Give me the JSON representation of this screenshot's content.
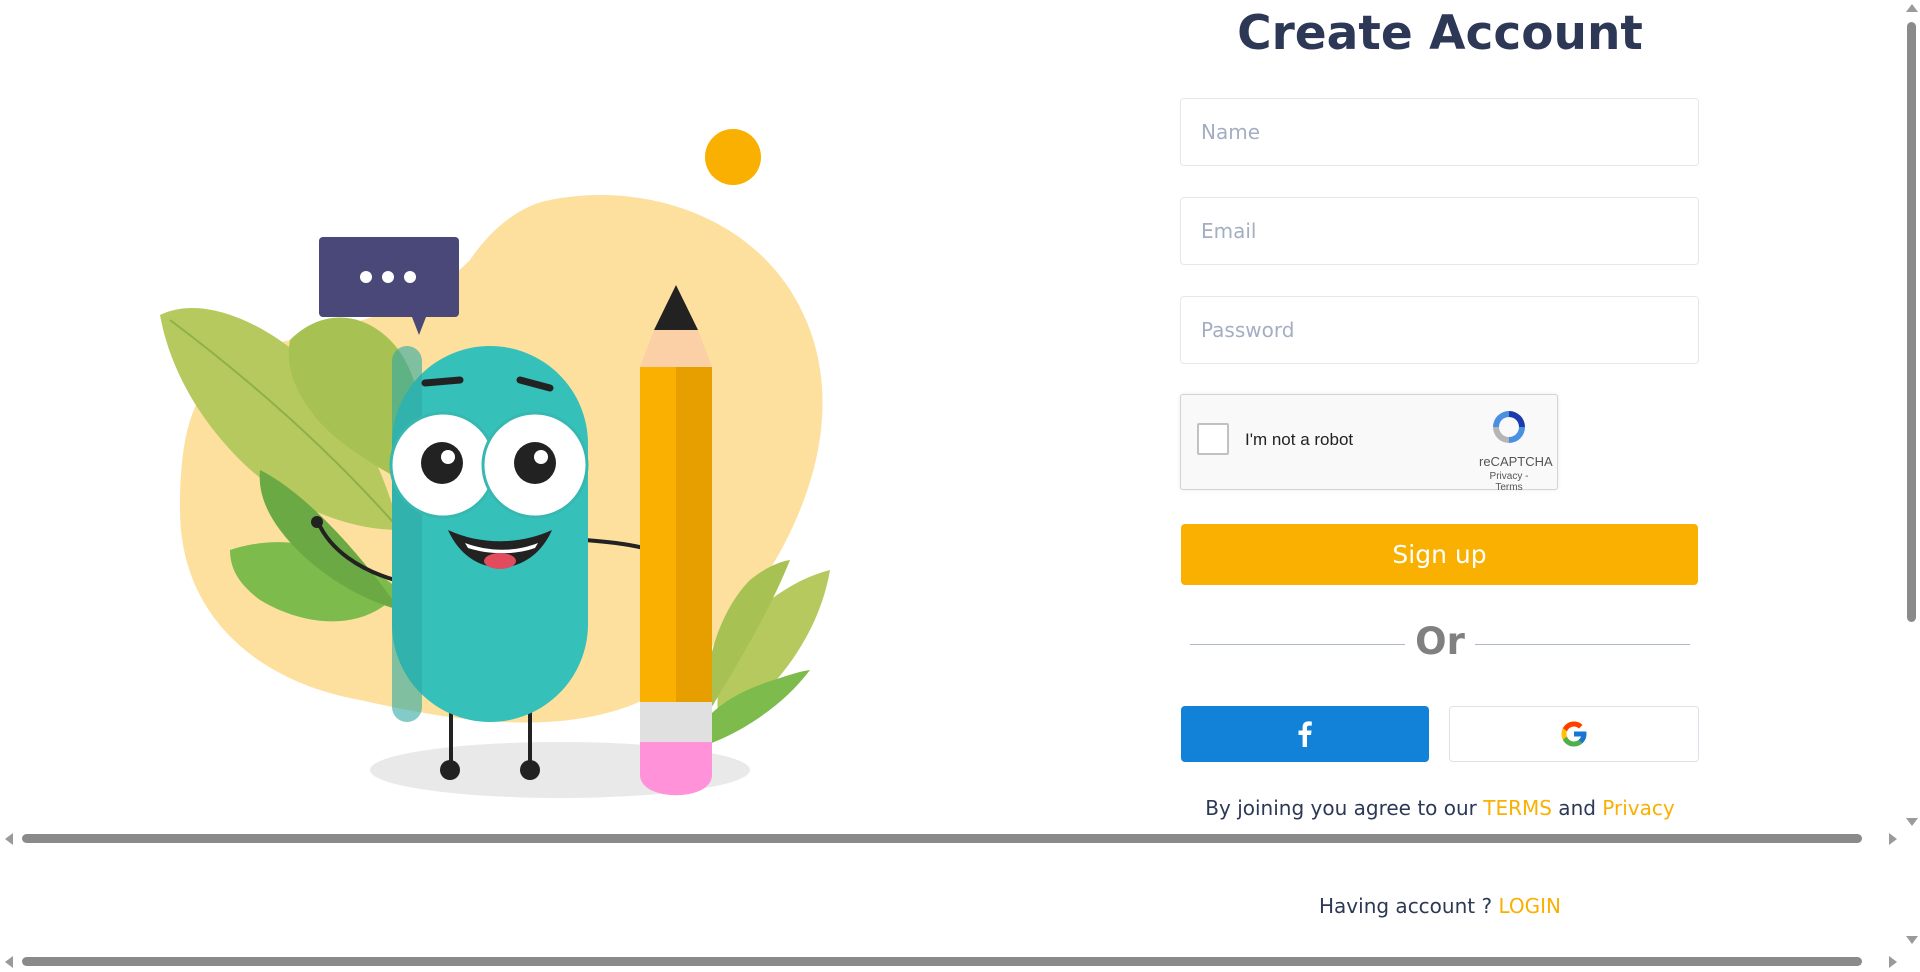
{
  "page": {
    "title": "Create Account"
  },
  "form": {
    "name_placeholder": "Name",
    "email_placeholder": "Email",
    "password_placeholder": "Password",
    "name_value": "",
    "email_value": "",
    "password_value": ""
  },
  "recaptcha": {
    "label": "I'm not a robot",
    "brand": "reCAPTCHA",
    "links": "Privacy - Terms",
    "checked": false
  },
  "actions": {
    "signup_label": "Sign up",
    "divider_label": "Or",
    "facebook_icon": "facebook-icon",
    "google_icon": "google-icon"
  },
  "terms": {
    "prefix": "By joining you agree to our ",
    "terms_link": "TERMS",
    "and": " and ",
    "privacy_link": "Privacy"
  },
  "login": {
    "prompt": "Having account ? ",
    "link": "LOGIN"
  },
  "colors": {
    "accent": "#f9b000",
    "facebook": "#1282d8",
    "text": "#2d3856",
    "blob": "#fde09d",
    "character": "#35c0b9"
  }
}
